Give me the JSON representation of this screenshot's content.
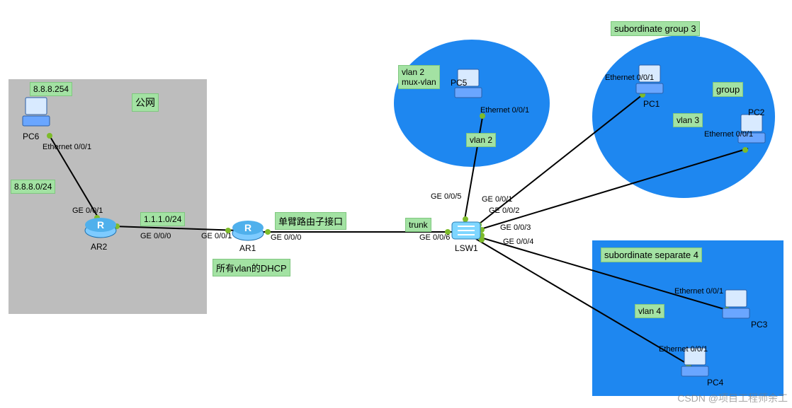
{
  "zones": {
    "public_net": {
      "label": "公网"
    },
    "group3": {
      "label": "subordinate group 3",
      "vlan": "vlan 3",
      "sublabel": "group"
    },
    "separate4": {
      "label": "subordinate separate 4",
      "vlan": "vlan 4"
    },
    "vlan2": {
      "label": "vlan 2\nmux-vlan",
      "vlan": "vlan 2"
    }
  },
  "devices": {
    "PC6": {
      "name": "PC6",
      "ip": "8.8.8.254",
      "port": "Ethernet 0/0/1"
    },
    "AR2": {
      "name": "AR2",
      "port": "GE 0/0/1",
      "port2": "GE 0/0/0"
    },
    "AR1": {
      "name": "AR1",
      "port": "GE 0/0/1",
      "port2": "GE 0/0/0",
      "note": "单臂路由子接口",
      "dhcp": "所有vlan的DHCP"
    },
    "LSW1": {
      "name": "LSW1",
      "ports": {
        "g1": "GE 0/0/1",
        "g2": "GE 0/0/2",
        "g3": "GE 0/0/3",
        "g4": "GE 0/0/4",
        "g5": "GE 0/0/5",
        "g6": "GE 0/0/6"
      }
    },
    "PC5": {
      "name": "PC5",
      "port": "Ethernet 0/0/1"
    },
    "PC1": {
      "name": "PC1",
      "port": "Ethernet 0/0/1"
    },
    "PC2": {
      "name": "PC2",
      "port": "Ethernet 0/0/1"
    },
    "PC3": {
      "name": "PC3",
      "port": "Ethernet 0/0/1"
    },
    "PC4": {
      "name": "PC4",
      "port": "Ethernet 0/0/1"
    }
  },
  "links": {
    "ar2_ar1": {
      "subnet": "1.1.1.0/24"
    },
    "pc6_ar2": {
      "subnet": "8.8.8.0/24"
    },
    "ar1_lsw1": {
      "mode": "trunk"
    }
  },
  "watermark": "CSDN @项目工程师余工"
}
